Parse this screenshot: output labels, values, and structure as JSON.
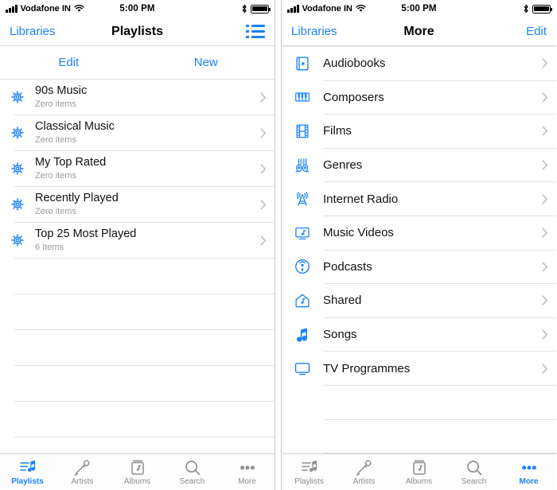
{
  "status_bar": {
    "carrier": "Vodafone IN",
    "time": "5:00 PM",
    "signal_icon": "signal-bars-icon",
    "wifi_icon": "wifi-icon",
    "bluetooth_icon": "bluetooth-icon",
    "battery_icon": "battery-full-icon"
  },
  "colors": {
    "accent": "#1a82fb",
    "text_primary": "#111111",
    "text_secondary": "#9a9a9a",
    "separator": "#e2e2e4",
    "tab_inactive": "#8e8e93"
  },
  "left_screen": {
    "nav": {
      "back_label": "Libraries",
      "title": "Playlists",
      "right_icon": "list-view-icon"
    },
    "toolbar": {
      "edit_label": "Edit",
      "new_label": "New"
    },
    "playlists": [
      {
        "icon": "smart-playlist-gear-icon",
        "name": "90s Music",
        "count": "Zero items"
      },
      {
        "icon": "smart-playlist-gear-icon",
        "name": "Classical Music",
        "count": "Zero items"
      },
      {
        "icon": "smart-playlist-gear-icon",
        "name": "My Top Rated",
        "count": "Zero items"
      },
      {
        "icon": "smart-playlist-gear-icon",
        "name": "Recently Played",
        "count": "Zero items"
      },
      {
        "icon": "smart-playlist-gear-icon",
        "name": "Top 25 Most Played",
        "count": "6 Items"
      }
    ],
    "empty_rows": 5,
    "tabs": [
      {
        "label": "Playlists",
        "icon": "playlists-icon",
        "active": true
      },
      {
        "label": "Artists",
        "icon": "artists-microphone-icon",
        "active": false
      },
      {
        "label": "Albums",
        "icon": "albums-icon",
        "active": false
      },
      {
        "label": "Search",
        "icon": "search-icon",
        "active": false
      },
      {
        "label": "More",
        "icon": "more-dots-icon",
        "active": false
      }
    ]
  },
  "right_screen": {
    "nav": {
      "back_label": "Libraries",
      "title": "More",
      "edit_label": "Edit"
    },
    "items": [
      {
        "icon": "audiobooks-icon",
        "label": "Audiobooks"
      },
      {
        "icon": "composers-piano-icon",
        "label": "Composers"
      },
      {
        "icon": "films-filmstrip-icon",
        "label": "Films"
      },
      {
        "icon": "genres-guitars-icon",
        "label": "Genres"
      },
      {
        "icon": "internet-radio-tower-icon",
        "label": "Internet Radio"
      },
      {
        "icon": "music-videos-icon",
        "label": "Music Videos"
      },
      {
        "icon": "podcasts-icon",
        "label": "Podcasts"
      },
      {
        "icon": "shared-house-icon",
        "label": "Shared"
      },
      {
        "icon": "songs-note-icon",
        "label": "Songs"
      },
      {
        "icon": "tv-programmes-icon",
        "label": "TV Programmes"
      }
    ],
    "empty_rows": 2,
    "tabs": [
      {
        "label": "Playlists",
        "icon": "playlists-icon",
        "active": false
      },
      {
        "label": "Artists",
        "icon": "artists-microphone-icon",
        "active": false
      },
      {
        "label": "Albums",
        "icon": "albums-icon",
        "active": false
      },
      {
        "label": "Search",
        "icon": "search-icon",
        "active": false
      },
      {
        "label": "More",
        "icon": "more-dots-icon",
        "active": true
      }
    ]
  }
}
